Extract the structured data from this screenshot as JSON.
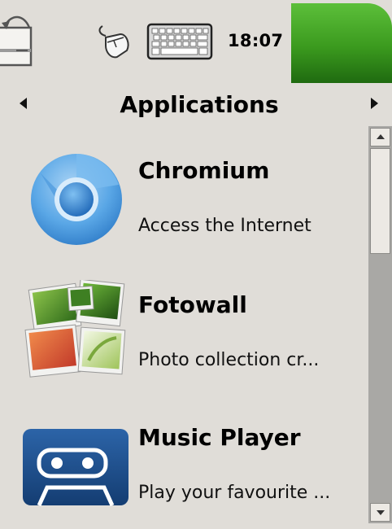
{
  "status_bar": {
    "time": "18:07",
    "icons": [
      "rotate-screen-icon",
      "mouse-icon",
      "keyboard-icon"
    ]
  },
  "header": {
    "title": "Applications"
  },
  "apps": [
    {
      "name": "Chromium",
      "description": "Access the Internet",
      "icon": "chromium-icon"
    },
    {
      "name": "Fotowall",
      "description": "Photo collection cr...",
      "icon": "fotowall-icon"
    },
    {
      "name": "Music Player",
      "description": "Play your favourite ...",
      "icon": "music-player-icon"
    }
  ],
  "colors": {
    "background": "#e0ddd8",
    "accent_green": "#3b9a1e",
    "chromium_blue": "#3f8fd6",
    "music_player_blue": "#1c4f8e"
  }
}
